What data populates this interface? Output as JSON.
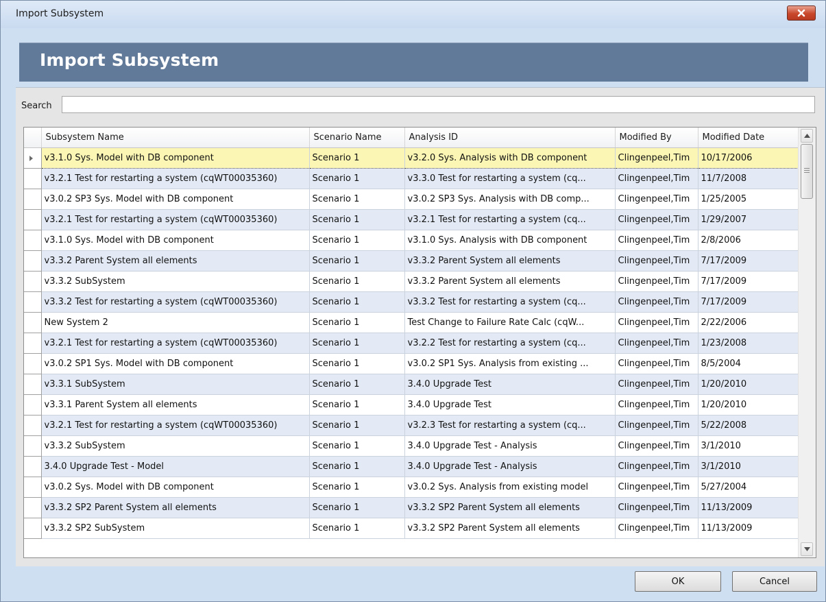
{
  "window": {
    "title": "Import Subsystem",
    "close_icon": "close-icon"
  },
  "header": {
    "heading": "Import Subsystem"
  },
  "search": {
    "label": "Search",
    "value": "",
    "placeholder": ""
  },
  "grid": {
    "columns": [
      "Subsystem Name",
      "Scenario Name",
      "Analysis ID",
      "Modified By",
      "Modified Date"
    ],
    "selected_row": 0,
    "rows": [
      [
        "v3.1.0 Sys. Model with DB component",
        "Scenario 1",
        "v3.2.0 Sys. Analysis with DB component",
        "Clingenpeel,Tim",
        "10/17/2006"
      ],
      [
        "v3.2.1 Test for restarting a system (cqWT00035360)",
        "Scenario 1",
        "v3.3.0 Test for restarting a system (cq...",
        "Clingenpeel,Tim",
        "11/7/2008"
      ],
      [
        "v3.0.2 SP3 Sys. Model with DB component",
        "Scenario 1",
        "v3.0.2 SP3 Sys. Analysis with DB comp...",
        "Clingenpeel,Tim",
        "1/25/2005"
      ],
      [
        "v3.2.1 Test for restarting a system (cqWT00035360)",
        "Scenario 1",
        "v3.2.1 Test for restarting a system (cq...",
        "Clingenpeel,Tim",
        "1/29/2007"
      ],
      [
        "v3.1.0 Sys. Model with DB component",
        "Scenario 1",
        "v3.1.0 Sys. Analysis with DB component",
        "Clingenpeel,Tim",
        "2/8/2006"
      ],
      [
        "v3.3.2 Parent System all elements",
        "Scenario 1",
        "v3.3.2 Parent System all elements",
        "Clingenpeel,Tim",
        "7/17/2009"
      ],
      [
        "v3.3.2 SubSystem",
        "Scenario 1",
        "v3.3.2 Parent System all elements",
        "Clingenpeel,Tim",
        "7/17/2009"
      ],
      [
        "v3.3.2 Test for restarting a system (cqWT00035360)",
        "Scenario 1",
        "v3.3.2 Test for restarting a system (cq...",
        "Clingenpeel,Tim",
        "7/17/2009"
      ],
      [
        "New System 2",
        "Scenario 1",
        "Test Change to Failure Rate Calc (cqW...",
        "Clingenpeel,Tim",
        "2/22/2006"
      ],
      [
        "v3.2.1 Test for restarting a system (cqWT00035360)",
        "Scenario 1",
        "v3.2.2 Test for restarting a system (cq...",
        "Clingenpeel,Tim",
        "1/23/2008"
      ],
      [
        "v3.0.2 SP1 Sys. Model with DB component",
        "Scenario 1",
        "v3.0.2 SP1 Sys. Analysis from existing ...",
        "Clingenpeel,Tim",
        "8/5/2004"
      ],
      [
        "v3.3.1 SubSystem",
        "Scenario 1",
        "3.4.0 Upgrade Test",
        "Clingenpeel,Tim",
        "1/20/2010"
      ],
      [
        "v3.3.1 Parent System all elements",
        "Scenario 1",
        "3.4.0 Upgrade Test",
        "Clingenpeel,Tim",
        "1/20/2010"
      ],
      [
        "v3.2.1 Test for restarting a system (cqWT00035360)",
        "Scenario 1",
        "v3.2.3 Test for restarting a system (cq...",
        "Clingenpeel,Tim",
        "5/22/2008"
      ],
      [
        "v3.3.2 SubSystem",
        "Scenario 1",
        "3.4.0 Upgrade Test - Analysis",
        "Clingenpeel,Tim",
        "3/1/2010"
      ],
      [
        "3.4.0 Upgrade Test - Model",
        "Scenario 1",
        "3.4.0 Upgrade Test - Analysis",
        "Clingenpeel,Tim",
        "3/1/2010"
      ],
      [
        "v3.0.2 Sys. Model with DB component",
        "Scenario 1",
        "v3.0.2 Sys. Analysis from existing model",
        "Clingenpeel,Tim",
        "5/27/2004"
      ],
      [
        "v3.3.2 SP2 Parent System all elements",
        "Scenario 1",
        "v3.3.2 SP2 Parent System all elements",
        "Clingenpeel,Tim",
        "11/13/2009"
      ],
      [
        "v3.3.2 SP2 SubSystem",
        "Scenario 1",
        "v3.3.2 SP2 Parent System all elements",
        "Clingenpeel,Tim",
        "11/13/2009"
      ]
    ]
  },
  "buttons": {
    "ok": "OK",
    "cancel": "Cancel"
  },
  "colors": {
    "banner": "#627a99",
    "selected_row": "#fbf6b4",
    "alt_row": "#e3eaf5",
    "close_button": "#c9472b"
  }
}
